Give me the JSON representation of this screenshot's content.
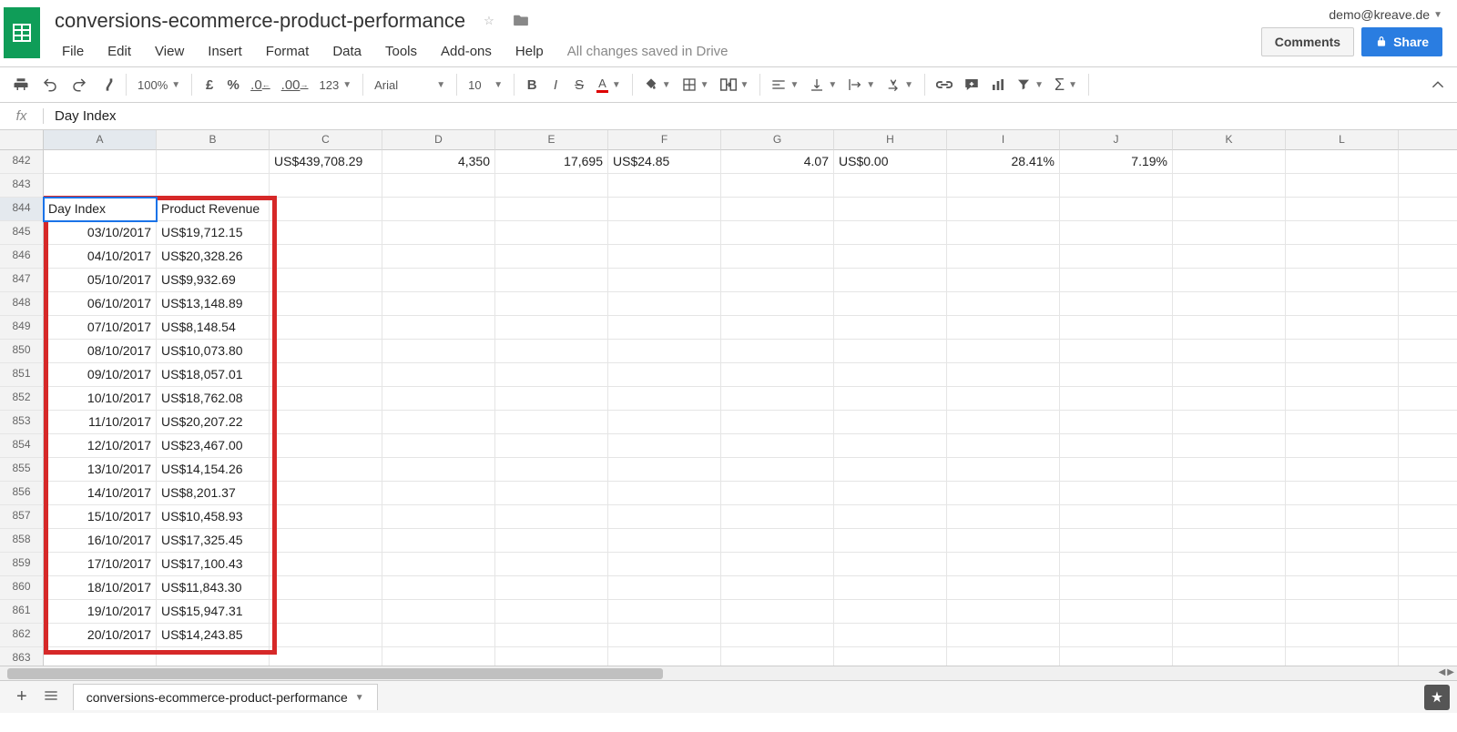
{
  "header": {
    "doc_title": "conversions-ecommerce-product-performance",
    "user_email": "demo@kreave.de",
    "comments_label": "Comments",
    "share_label": "Share",
    "save_status": "All changes saved in Drive"
  },
  "menu": [
    "File",
    "Edit",
    "View",
    "Insert",
    "Format",
    "Data",
    "Tools",
    "Add-ons",
    "Help"
  ],
  "toolbar": {
    "zoom": "100%",
    "currency": "£",
    "percent": "%",
    "dec_dec": ".0",
    "inc_dec": ".00",
    "format_menu": "123",
    "font": "Arial",
    "font_size": "10"
  },
  "formula_bar": {
    "fx": "fx",
    "value": "Day Index"
  },
  "columns": [
    "A",
    "B",
    "C",
    "D",
    "E",
    "F",
    "G",
    "H",
    "I",
    "J",
    "K",
    "L"
  ],
  "rows_start": 842,
  "row_count": 21,
  "summary_row": {
    "C": "US$439,708.29",
    "D": "4,350",
    "E": "17,695",
    "F": "US$24.85",
    "G": "4.07",
    "H": "US$0.00",
    "I": "28.41%",
    "J": "7.19%"
  },
  "table_header": {
    "A": "Day Index",
    "B": "Product Revenue"
  },
  "table_rows": [
    {
      "A": "03/10/2017",
      "B": "US$19,712.15"
    },
    {
      "A": "04/10/2017",
      "B": "US$20,328.26"
    },
    {
      "A": "05/10/2017",
      "B": "US$9,932.69"
    },
    {
      "A": "06/10/2017",
      "B": "US$13,148.89"
    },
    {
      "A": "07/10/2017",
      "B": "US$8,148.54"
    },
    {
      "A": "08/10/2017",
      "B": "US$10,073.80"
    },
    {
      "A": "09/10/2017",
      "B": "US$18,057.01"
    },
    {
      "A": "10/10/2017",
      "B": "US$18,762.08"
    },
    {
      "A": "11/10/2017",
      "B": "US$20,207.22"
    },
    {
      "A": "12/10/2017",
      "B": "US$23,467.00"
    },
    {
      "A": "13/10/2017",
      "B": "US$14,154.26"
    },
    {
      "A": "14/10/2017",
      "B": "US$8,201.37"
    },
    {
      "A": "15/10/2017",
      "B": "US$10,458.93"
    },
    {
      "A": "16/10/2017",
      "B": "US$17,325.45"
    },
    {
      "A": "17/10/2017",
      "B": "US$17,100.43"
    },
    {
      "A": "18/10/2017",
      "B": "US$11,843.30"
    },
    {
      "A": "19/10/2017",
      "B": "US$15,947.31"
    },
    {
      "A": "20/10/2017",
      "B": "US$14,243.85"
    }
  ],
  "sheet_tab": "conversions-ecommerce-product-performance"
}
